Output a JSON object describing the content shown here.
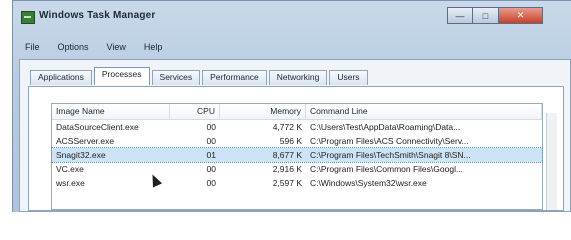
{
  "window": {
    "title": "Windows Task Manager",
    "controls": {
      "minimize": "—",
      "maximize": "□",
      "close": "✕"
    }
  },
  "menu": [
    "File",
    "Options",
    "View",
    "Help"
  ],
  "tabs": [
    "Applications",
    "Processes",
    "Services",
    "Performance",
    "Networking",
    "Users"
  ],
  "active_tab": "Processes",
  "table": {
    "columns": [
      "Image Name",
      "CPU",
      "Memory",
      "Command Line"
    ],
    "rows": [
      {
        "image": "DataSourceClient.exe",
        "cpu": "00",
        "memory": "4,772 K",
        "command": "C:\\Users\\Test\\AppData\\Roaming\\Data..."
      },
      {
        "image": "ACSServer.exe",
        "cpu": "00",
        "memory": "596 K",
        "command": "C:\\Program Files\\ACS Connectivity\\Serv..."
      },
      {
        "image": "Snagit32.exe",
        "cpu": "01",
        "memory": "8,677 K",
        "command": "C:\\Program Files\\TechSmith\\Snagit 8\\SN..."
      },
      {
        "image": "VC.exe",
        "cpu": "00",
        "memory": "2,916 K",
        "command": "C:\\Program Files\\Common Files\\Googl..."
      },
      {
        "image": "wsr.exe",
        "cpu": "00",
        "memory": "2,597 K",
        "command": "C:\\Windows\\System32\\wsr.exe"
      }
    ],
    "selected_row": 2
  },
  "icons": {
    "app": "task-manager-icon",
    "cursor": "mouse-cursor-icon"
  }
}
